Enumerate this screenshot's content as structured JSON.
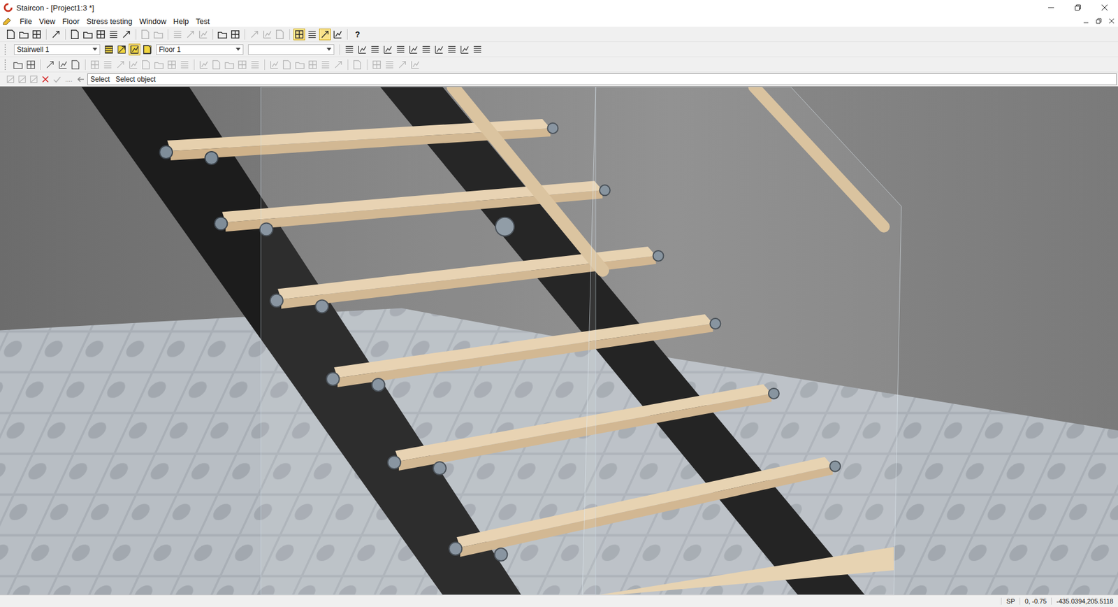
{
  "window": {
    "title": "Staircon - [Project1:3 *]"
  },
  "menu": [
    "File",
    "View",
    "Floor",
    "Stress testing",
    "Window",
    "Help",
    "Test"
  ],
  "toolbar1": [
    {
      "kind": "button",
      "pressed": false,
      "disabled": false
    },
    {
      "kind": "button",
      "pressed": false,
      "disabled": false
    },
    {
      "kind": "button",
      "pressed": false,
      "disabled": false
    },
    {
      "kind": "separator"
    },
    {
      "kind": "button",
      "pressed": false,
      "disabled": false
    },
    {
      "kind": "separator"
    },
    {
      "kind": "button",
      "pressed": false,
      "disabled": false
    },
    {
      "kind": "button",
      "pressed": false,
      "disabled": false
    },
    {
      "kind": "button",
      "pressed": false,
      "disabled": false
    },
    {
      "kind": "button",
      "pressed": false,
      "disabled": false
    },
    {
      "kind": "button",
      "pressed": false,
      "disabled": false
    },
    {
      "kind": "separator"
    },
    {
      "kind": "button",
      "pressed": false,
      "disabled": true
    },
    {
      "kind": "button",
      "pressed": false,
      "disabled": true
    },
    {
      "kind": "separator"
    },
    {
      "kind": "button",
      "pressed": false,
      "disabled": true
    },
    {
      "kind": "button",
      "pressed": false,
      "disabled": true
    },
    {
      "kind": "button",
      "pressed": false,
      "disabled": true
    },
    {
      "kind": "separator"
    },
    {
      "kind": "button",
      "pressed": false,
      "disabled": false
    },
    {
      "kind": "button",
      "pressed": false,
      "disabled": false
    },
    {
      "kind": "separator"
    },
    {
      "kind": "button",
      "pressed": false,
      "disabled": true
    },
    {
      "kind": "button",
      "pressed": false,
      "disabled": true
    },
    {
      "kind": "button",
      "pressed": false,
      "disabled": true
    },
    {
      "kind": "separator"
    },
    {
      "kind": "button",
      "pressed": true,
      "disabled": false
    },
    {
      "kind": "button",
      "pressed": false,
      "disabled": false
    },
    {
      "kind": "button",
      "pressed": true,
      "disabled": false
    },
    {
      "kind": "button",
      "pressed": false,
      "disabled": false
    },
    {
      "kind": "separator"
    },
    {
      "kind": "text",
      "text": "?"
    }
  ],
  "toolbar2": {
    "stairwell": "Stairwell 1",
    "stairwell_tools": [
      {
        "pressed": false,
        "disabled": false
      },
      {
        "pressed": false,
        "disabled": false
      },
      {
        "pressed": true,
        "disabled": false
      },
      {
        "pressed": false,
        "disabled": false
      }
    ],
    "floor": "Floor 1",
    "level": "",
    "align_tools": [
      {
        "pressed": false,
        "disabled": false
      },
      {
        "pressed": false,
        "disabled": false
      },
      {
        "pressed": false,
        "disabled": false
      },
      {
        "pressed": false,
        "disabled": false
      },
      {
        "pressed": false,
        "disabled": false
      },
      {
        "pressed": false,
        "disabled": false
      },
      {
        "pressed": false,
        "disabled": false
      },
      {
        "pressed": false,
        "disabled": false
      },
      {
        "pressed": false,
        "disabled": false
      },
      {
        "pressed": false,
        "disabled": false
      },
      {
        "pressed": false,
        "disabled": false
      }
    ]
  },
  "toolbar3": [
    {
      "kind": "button",
      "disabled": false
    },
    {
      "kind": "button",
      "disabled": false
    },
    {
      "kind": "separator"
    },
    {
      "kind": "button",
      "disabled": false
    },
    {
      "kind": "button",
      "disabled": false
    },
    {
      "kind": "button",
      "disabled": false
    },
    {
      "kind": "separator"
    },
    {
      "kind": "button",
      "disabled": true
    },
    {
      "kind": "button",
      "disabled": true
    },
    {
      "kind": "button",
      "disabled": true
    },
    {
      "kind": "button",
      "disabled": true
    },
    {
      "kind": "button",
      "disabled": true
    },
    {
      "kind": "button",
      "disabled": true
    },
    {
      "kind": "button",
      "disabled": true
    },
    {
      "kind": "button",
      "disabled": true
    },
    {
      "kind": "separator"
    },
    {
      "kind": "button",
      "disabled": true
    },
    {
      "kind": "button",
      "disabled": true
    },
    {
      "kind": "button",
      "disabled": true
    },
    {
      "kind": "button",
      "disabled": true
    },
    {
      "kind": "button",
      "disabled": true
    },
    {
      "kind": "separator"
    },
    {
      "kind": "button",
      "disabled": true
    },
    {
      "kind": "button",
      "disabled": true
    },
    {
      "kind": "button",
      "disabled": true
    },
    {
      "kind": "button",
      "disabled": true
    },
    {
      "kind": "button",
      "disabled": true
    },
    {
      "kind": "button",
      "disabled": true
    },
    {
      "kind": "separator"
    },
    {
      "kind": "button",
      "disabled": true
    },
    {
      "kind": "separator"
    },
    {
      "kind": "button",
      "disabled": true
    },
    {
      "kind": "button",
      "disabled": true
    },
    {
      "kind": "button",
      "disabled": true
    },
    {
      "kind": "button",
      "disabled": true
    }
  ],
  "command": {
    "tools": [
      {
        "kind": "tool",
        "disabled": true
      },
      {
        "kind": "tool",
        "disabled": true
      },
      {
        "kind": "tool",
        "disabled": true
      },
      {
        "kind": "cancel",
        "disabled": false
      },
      {
        "kind": "confirm",
        "disabled": true
      }
    ],
    "more": "....",
    "label": "Select",
    "prompt": "Select object"
  },
  "status_bar": {
    "mode": "SP",
    "offset": "0, -0.75",
    "coords": "-435.0394,205.5118"
  }
}
